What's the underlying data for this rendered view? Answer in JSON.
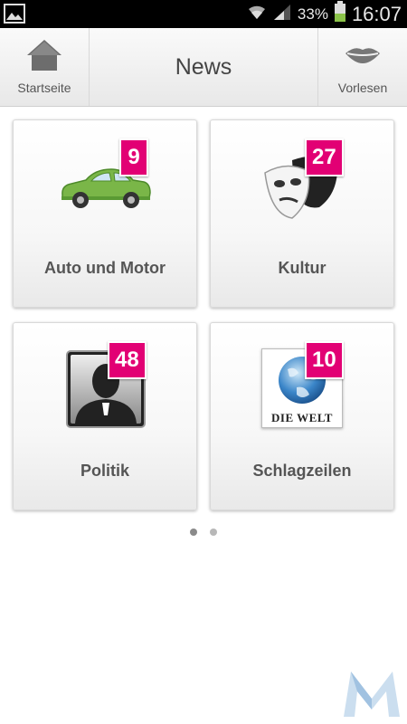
{
  "status_bar": {
    "battery_percent": "33%",
    "time": "16:07"
  },
  "action_bar": {
    "title": "News",
    "home_label": "Startseite",
    "read_label": "Vorlesen"
  },
  "tiles": [
    {
      "label": "Auto und Motor",
      "badge": "9",
      "icon": "car-icon"
    },
    {
      "label": "Kultur",
      "badge": "27",
      "icon": "theater-masks-icon"
    },
    {
      "label": "Politik",
      "badge": "48",
      "icon": "person-silhouette-icon"
    },
    {
      "label": "Schlagzeilen",
      "badge": "10",
      "icon": "die-welt-logo",
      "logo_text": "DIE WELT"
    }
  ],
  "pager": {
    "pages": 2,
    "current": 1
  },
  "colors": {
    "badge": "#e20074",
    "car": "#7ab648"
  }
}
